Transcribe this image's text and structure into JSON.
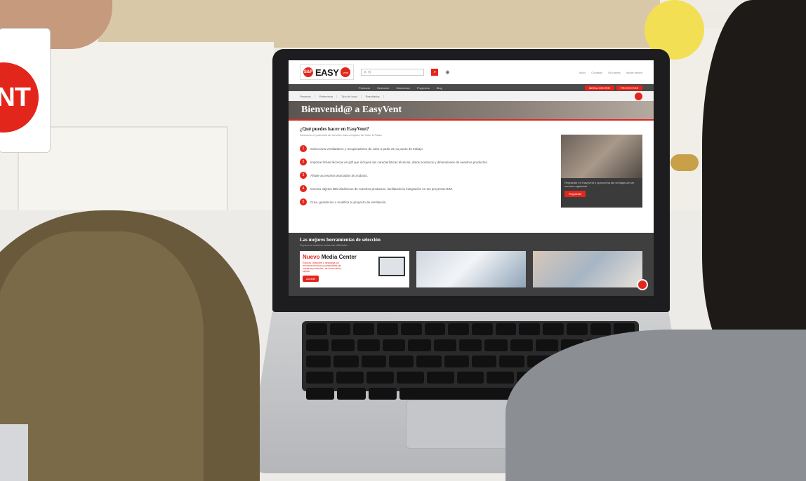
{
  "logo_card": {
    "text": "NT"
  },
  "site": {
    "brand": {
      "sp": "S&P",
      "easy": "EASY",
      "vent": "vent"
    },
    "search": {
      "placeholder": "p. ej."
    },
    "toplinks": [
      "Inicio",
      "Contacto",
      "Mi cuenta",
      "Iniciar sesión"
    ],
    "nav": [
      "Producto",
      "Selección",
      "Soluciones",
      "Proyectos",
      "Blog"
    ],
    "nav_buttons": [
      "MEDIA CENTER",
      "PROYECTOS"
    ],
    "breadcrumbs": [
      "Proyecto",
      "Referencia",
      "Tipo de local",
      "Resultados"
    ],
    "hero_title": "Bienvenid@ a EasyVent",
    "question_title": "¿Qué puedes hacer en EasyVent?",
    "question_sub": "Descubre el potencial del servicio más completo de Soler & Palau",
    "steps": [
      {
        "n": "1",
        "text": "Selecciona ventiladores y recuperadores de calor a partir de su punto de trabajo."
      },
      {
        "n": "2",
        "text": "Imprime fichas técnicas en pdf que incluyen las características técnicas, datos acústicos y dimensiones de nuestros productos."
      },
      {
        "n": "3",
        "text": "Añade accesorios asociados al producto."
      },
      {
        "n": "4",
        "text": "Genera objetos BIM dinámicos de nuestros productos, facilitando la integración en tus proyectos BIM."
      },
      {
        "n": "5",
        "text": "Crea, guarda tus o modifica tu proyecto de ventilación."
      }
    ],
    "promo": {
      "text": "Regístrate en EasyVent y aprovecha las ventajas de ser usuario registrado.",
      "button": "Regístrate"
    },
    "tools_title": "Las mejores herramientas de selección",
    "tools_sub": "Explora al máximo todas las utilidades",
    "media_center": {
      "title_new": "Nuevo",
      "title_rest": "Media Center",
      "text": "Explora, descubre y descarga los recursos técnicos y comerciales de nuestros productos, de forma fácil y rápida.",
      "button": "Accede"
    }
  }
}
